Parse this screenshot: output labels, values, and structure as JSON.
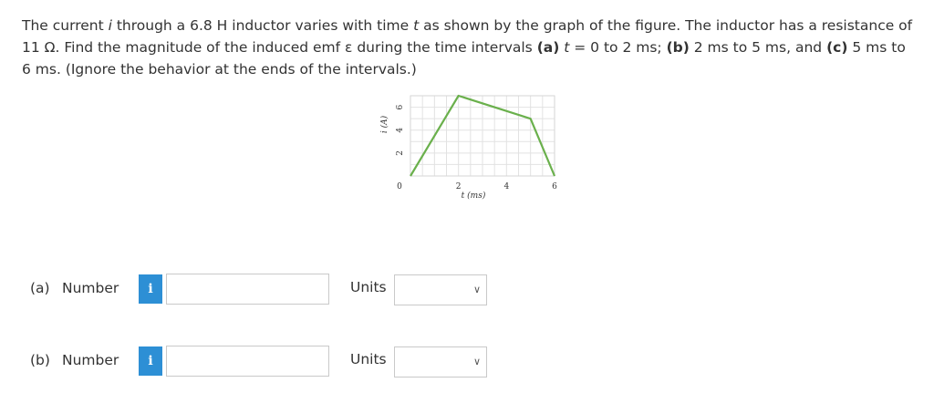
{
  "question": {
    "p1": "The current ",
    "var_i": "i",
    "p2": " through a 6.8 H inductor varies with time ",
    "var_t": "t",
    "p3": " as shown by the graph of the figure. The inductor has a resistance of 11 Ω. Find the magnitude of the induced emf ε during the time intervals ",
    "part_a": "(a)",
    "p4": " ",
    "var_t2": "t",
    "p5": " = 0 to 2 ms; ",
    "part_b": "(b)",
    "p6": " 2 ms to 5 ms, and ",
    "part_c": "(c)",
    "p7": " 5 ms to 6 ms. (Ignore the behavior at the ends of the intervals.)"
  },
  "chart_data": {
    "type": "line",
    "xlabel": "t (ms)",
    "ylabel": "i (A)",
    "xlim": [
      0,
      6
    ],
    "ylim": [
      0,
      7
    ],
    "x_ticks": [
      "2",
      "4",
      "6"
    ],
    "y_ticks": [
      "2",
      "4",
      "6"
    ],
    "origin_label": "0",
    "grid": true,
    "color": "#6ab04c",
    "series": [
      {
        "x": [
          0,
          2,
          5,
          6
        ],
        "y": [
          0,
          7,
          5,
          0
        ]
      }
    ]
  },
  "answers": [
    {
      "label": "(a)",
      "field": "Number",
      "info_icon": "i",
      "value": "",
      "units_label": "Units",
      "units_value": ""
    },
    {
      "label": "(b)",
      "field": "Number",
      "info_icon": "i",
      "value": "",
      "units_label": "Units",
      "units_value": ""
    }
  ]
}
